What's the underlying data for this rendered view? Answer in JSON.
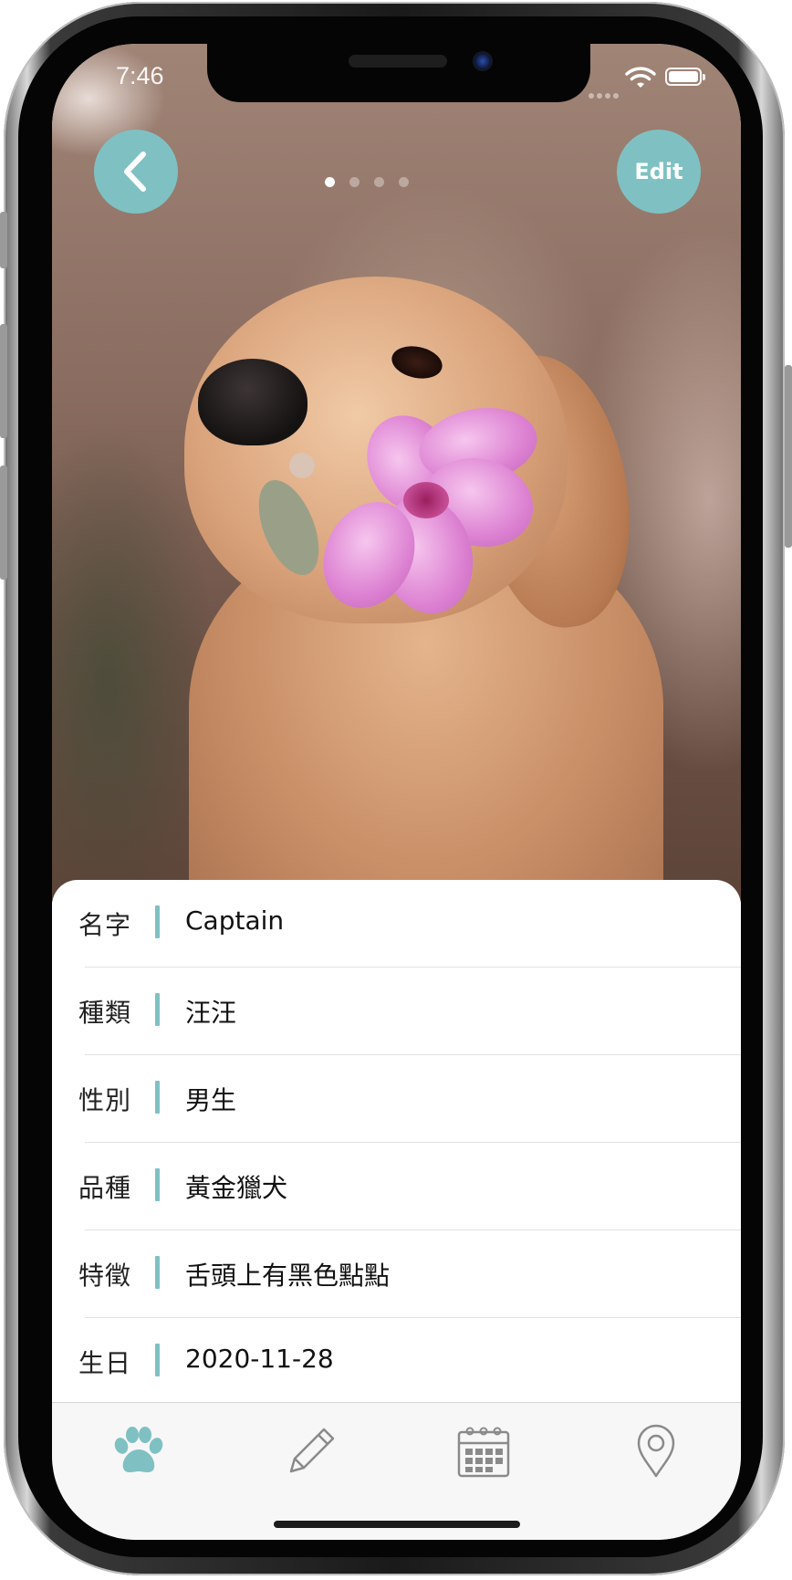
{
  "status_bar": {
    "time": "7:46"
  },
  "header": {
    "edit_label": "Edit",
    "photo_count": 4,
    "active_photo": 1
  },
  "pet_info": [
    {
      "label": "名字",
      "value": "Captain"
    },
    {
      "label": "種類",
      "value": "汪汪"
    },
    {
      "label": "性別",
      "value": "男生"
    },
    {
      "label": "品種",
      "value": "黃金獵犬"
    },
    {
      "label": "特徵",
      "value": "舌頭上有黑色點點"
    },
    {
      "label": "生日",
      "value": "2020-11-28"
    }
  ],
  "tab_bar": {
    "tabs": [
      {
        "icon": "paw-icon",
        "active": true
      },
      {
        "icon": "pencil-icon",
        "active": false
      },
      {
        "icon": "calendar-icon",
        "active": false
      },
      {
        "icon": "location-pin-icon",
        "active": false
      }
    ]
  },
  "colors": {
    "accent": "#7fc1c3",
    "inactive_icon": "#8a8a8a"
  }
}
